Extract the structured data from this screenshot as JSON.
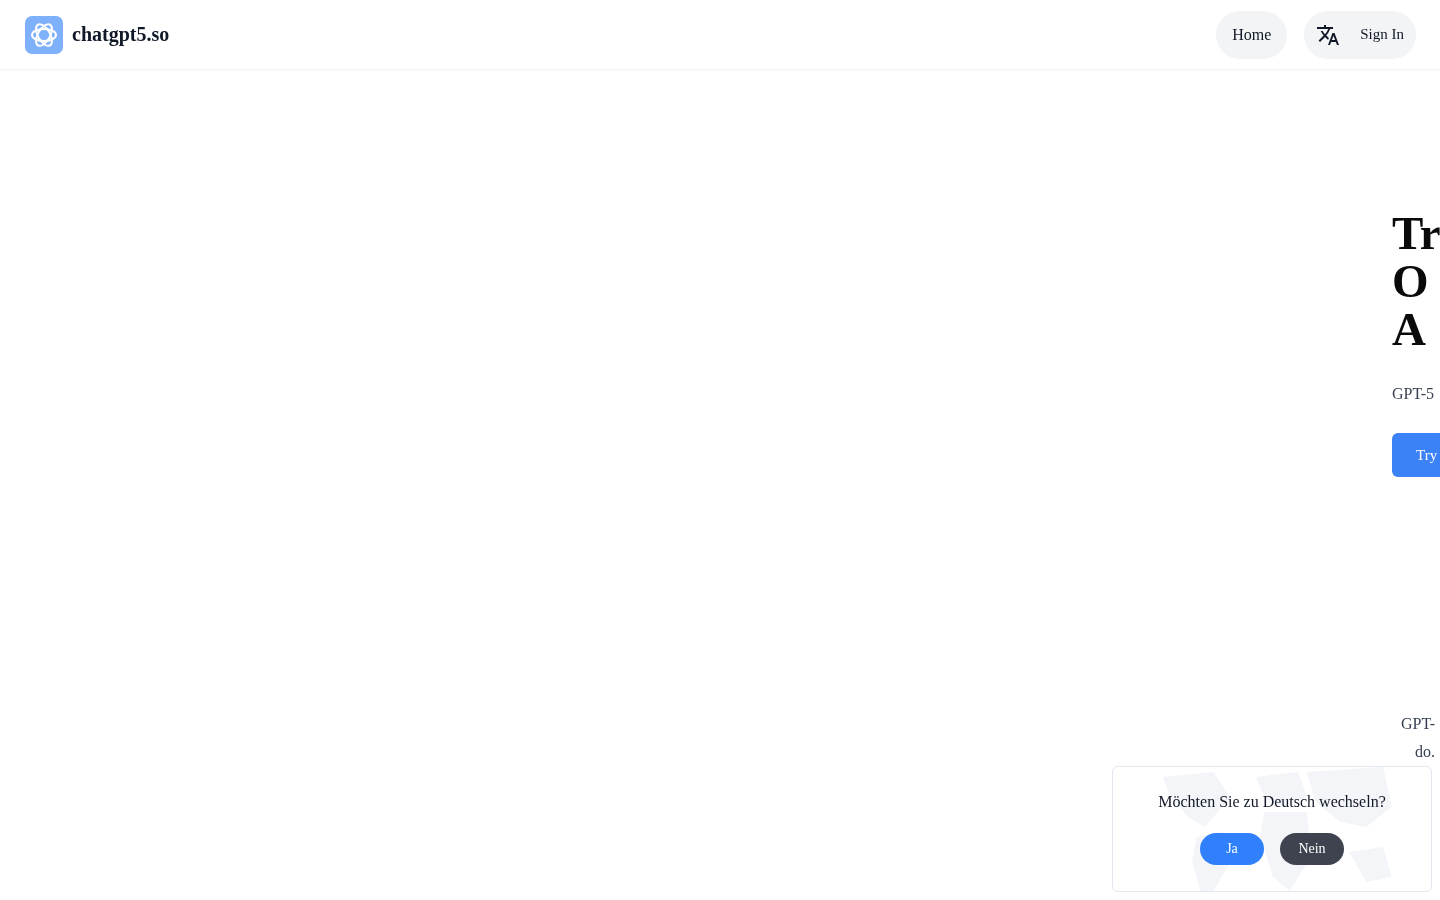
{
  "header": {
    "brand": "chatgpt5.so",
    "nav": [
      {
        "label": "Home",
        "kind": "link"
      },
      {
        "label": "Sign In",
        "kind": "language-signin"
      }
    ]
  },
  "hero": {
    "title_lines": [
      "Tr",
      "O",
      "A"
    ],
    "subtitle": "GPT-5",
    "cta": "Try"
  },
  "section": {
    "lines": [
      "GPT-",
      "do."
    ]
  },
  "language_prompt": {
    "question": "Möchten Sie zu Deutsch wechseln?",
    "buttons": [
      {
        "label": "Ja",
        "kind": "primary"
      },
      {
        "label": "Nein",
        "kind": "secondary"
      }
    ]
  }
}
